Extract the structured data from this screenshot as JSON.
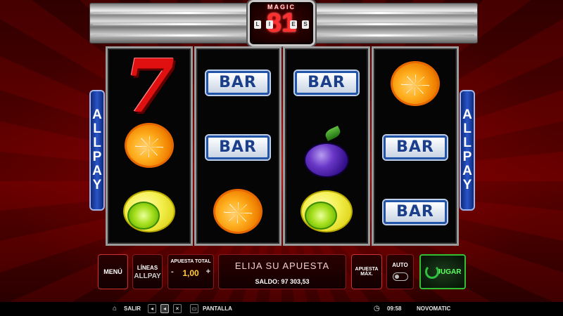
{
  "game": {
    "logo": {
      "top_word": "MAGIC",
      "number": "81",
      "side_letters": [
        "L",
        "I",
        "N",
        "E",
        "S"
      ]
    },
    "allpay_badge": [
      "A",
      "L",
      "L",
      "P",
      "A",
      "Y"
    ]
  },
  "reels": [
    [
      "seven",
      "orange",
      "lemon"
    ],
    [
      "bar",
      "bar",
      "orange"
    ],
    [
      "bar",
      "plum",
      "lemon"
    ],
    [
      "orange",
      "bar",
      "bar"
    ]
  ],
  "bar_label": "BAR",
  "seven_label": "7",
  "controls": {
    "menu": "MENÚ",
    "lines_label": "LÍNEAS",
    "lines_value": "ALLPAY",
    "bet_label": "APUESTA TOTAL",
    "bet_minus": "-",
    "bet_plus": "+",
    "bet_value": "1,00",
    "message": "ELIJA SU APUESTA",
    "balance": "SALDO: 97 303,53",
    "max_bet": "APUESTA MÁX.",
    "auto": "AUTO",
    "play": "JUGAR"
  },
  "statusbar": {
    "exit": "SALIR",
    "screen": "PANTALLA",
    "clock": "09:58",
    "brand": "NOVOMATIC"
  },
  "colors": {
    "accent_red": "#d03030",
    "play_green": "#30c030",
    "bet_gold": "#ffd040",
    "allpay_blue": "#2a55c8"
  }
}
